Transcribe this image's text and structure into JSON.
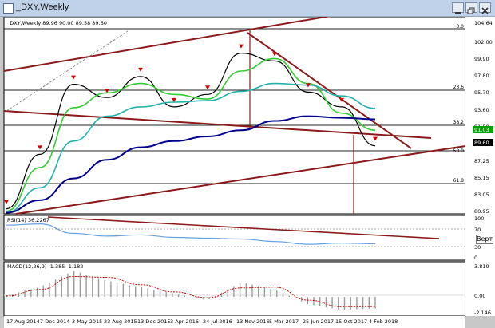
{
  "window": {
    "title": "_DXY,Weekly"
  },
  "side_tab": "Вертик",
  "price_panel": {
    "header": "_DXY,Weekly  89.96 90.00 89.58 89.60",
    "price_labels": [
      "104.64",
      "102.00",
      "99.90",
      "97.80",
      "95.70",
      "93.60",
      "91.50",
      "89.60",
      "87.25",
      "85.15",
      "83.05",
      "80.95"
    ],
    "fib_labels": [
      "0.0",
      "23.6",
      "38.2",
      "50.0",
      "61.8"
    ],
    "current_price": "89.60",
    "marker_price": "91.03"
  },
  "rsi_panel": {
    "header": "RSI(14) 36.2267",
    "levels": [
      "100",
      "70",
      "30",
      "0"
    ]
  },
  "macd_panel": {
    "header": "MACD(12,26,9) -1.385 -1.182",
    "levels": [
      "3.819",
      "0.00",
      "-2.146"
    ]
  },
  "time_axis": [
    "17 Aug 2014",
    "7 Dec 2014",
    "3 May 2015",
    "23 Aug 2015",
    "13 Dec 2015",
    "3 Apr 2016",
    "24 Jul 2016",
    "13 Nov 2016",
    "5 Mar 2017",
    "25 Jun 2017",
    "15 Oct 2017",
    "4 Feb 2018"
  ],
  "chart_data": {
    "type": "line",
    "x": [
      "17 Aug 2014",
      "7 Dec 2014",
      "3 May 2015",
      "23 Aug 2015",
      "13 Dec 2015",
      "3 Apr 2016",
      "24 Jul 2016",
      "13 Nov 2016",
      "5 Mar 2017",
      "25 Jun 2017",
      "15 Oct 2017",
      "4 Feb 2018"
    ],
    "ylim": [
      80.95,
      104.64
    ],
    "series": [
      {
        "values": [
          81.5,
          88.5,
          97.5,
          95.8,
          98.5,
          94.6,
          96.2,
          101.5,
          100.5,
          96.5,
          94.6,
          89.6
        ],
        "color": "#000000"
      },
      {
        "values": [
          81.2,
          86.8,
          94.5,
          96.4,
          97.6,
          96.2,
          95.6,
          99.2,
          100.8,
          97.6,
          93.8,
          91.6
        ],
        "color": "#33cc33"
      },
      {
        "values": [
          81.0,
          84.2,
          90.2,
          93.4,
          94.6,
          95.2,
          95.4,
          96.6,
          97.6,
          97.4,
          96.0,
          94.4
        ],
        "color": "#20b2aa"
      },
      {
        "values": [
          81.0,
          82.6,
          85.4,
          87.8,
          89.4,
          90.2,
          90.8,
          91.6,
          92.8,
          93.4,
          93.2,
          93.0
        ],
        "color": "#00008b"
      }
    ],
    "rsi": {
      "ylim": [
        0,
        100
      ],
      "values": [
        82,
        85,
        62,
        55,
        58,
        52,
        50,
        48,
        42,
        35,
        38,
        36.2
      ],
      "color": "#6aa0e0"
    },
    "macd": {
      "ylim": [
        -2.146,
        3.819
      ],
      "histogram": [
        0.2,
        1.2,
        3.2,
        2.0,
        1.2,
        0.4,
        -0.4,
        1.8,
        0.9,
        -0.9,
        -1.6,
        -1.4
      ],
      "signal": [
        0.1,
        0.9,
        2.5,
        2.4,
        1.5,
        0.6,
        -0.1,
        1.1,
        1.2,
        -0.4,
        -1.2,
        -1.18
      ],
      "histogram_color": "#9a9a9a",
      "signal_color": "#cc0000"
    }
  }
}
